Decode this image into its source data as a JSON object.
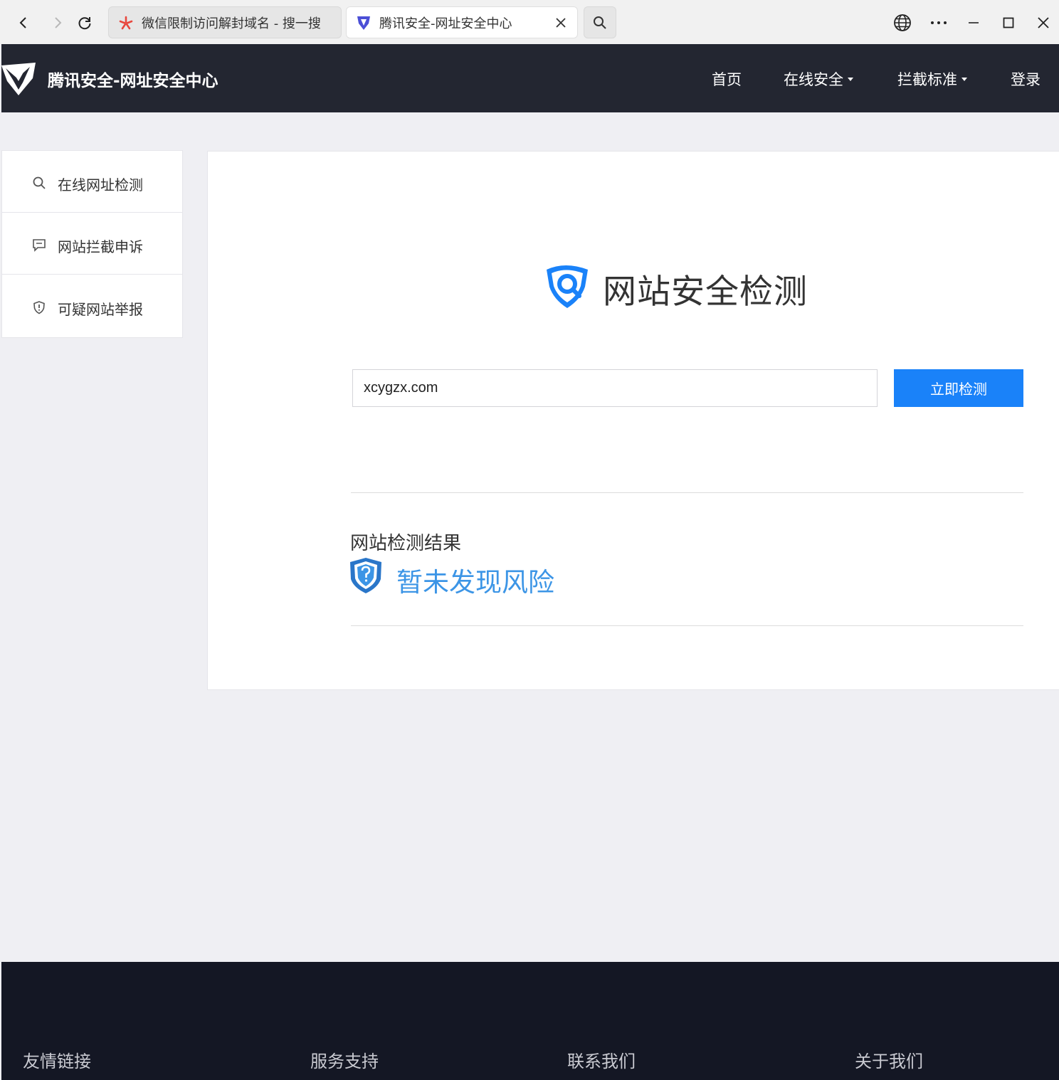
{
  "browser": {
    "tabs": [
      {
        "title": "微信限制访问解封域名 - 搜一搜",
        "active": false,
        "favicon": "sou-yi-sou-logo"
      },
      {
        "title": "腾讯安全-网址安全中心",
        "active": true,
        "favicon": "tencent-security-logo"
      }
    ]
  },
  "header": {
    "brand": "腾讯安全-网址安全中心",
    "nav": [
      {
        "label": "首页"
      },
      {
        "label": "在线安全",
        "dropdown": true
      },
      {
        "label": "拦截标准",
        "dropdown": true
      },
      {
        "label": "登录"
      }
    ]
  },
  "sidebar": {
    "items": [
      {
        "label": "在线网址检测",
        "icon": "search-icon"
      },
      {
        "label": "网站拦截申诉",
        "icon": "message-icon"
      },
      {
        "label": "可疑网站举报",
        "icon": "shield-alert-icon"
      }
    ]
  },
  "main": {
    "title": "网站安全检测",
    "url_value": "xcygzx.com",
    "check_button": "立即检测",
    "result_label": "网站检测结果",
    "result_text": "暂未发现风险"
  },
  "footer": {
    "headings": [
      "友情链接",
      "服务支持",
      "联系我们",
      "关于我们"
    ]
  },
  "colors": {
    "header_bg": "#232631",
    "accent": "#1a82f9",
    "result": "#3c95e6",
    "footer_bg": "#141724"
  }
}
